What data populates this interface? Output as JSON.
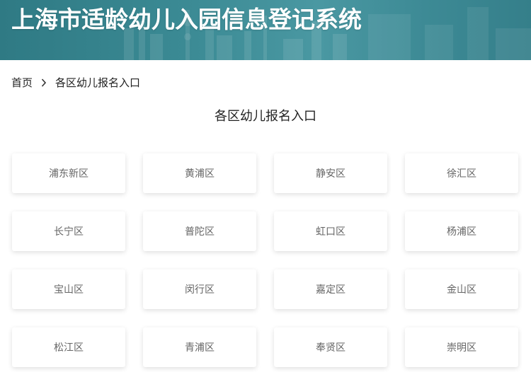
{
  "header": {
    "title": "上海市适龄幼儿入园信息登记系统"
  },
  "breadcrumb": {
    "home": "首页",
    "current": "各区幼儿报名入口"
  },
  "section": {
    "title": "各区幼儿报名入口"
  },
  "districts": [
    "浦东新区",
    "黄浦区",
    "静安区",
    "徐汇区",
    "长宁区",
    "普陀区",
    "虹口区",
    "杨浦区",
    "宝山区",
    "闵行区",
    "嘉定区",
    "金山区",
    "松江区",
    "青浦区",
    "奉贤区",
    "崇明区"
  ],
  "colors": {
    "banner": "#3b8a94",
    "card_text": "#666666",
    "text": "#222222"
  }
}
